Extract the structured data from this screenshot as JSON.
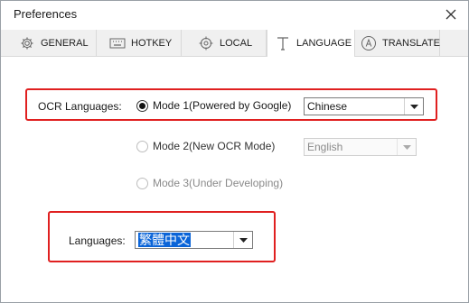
{
  "window": {
    "title": "Preferences"
  },
  "tabs": [
    {
      "label": "GENERAL",
      "icon": "gear-icon",
      "active": false
    },
    {
      "label": "HOTKEY",
      "icon": "keyboard-icon",
      "active": false
    },
    {
      "label": "LOCAL",
      "icon": "target-icon",
      "active": false
    },
    {
      "label": "LANGUAGE",
      "icon": "text-icon",
      "active": true
    },
    {
      "label": "TRANSLATE",
      "icon": "translate-icon",
      "active": false
    }
  ],
  "ocr": {
    "label": "OCR Languages:",
    "mode1": {
      "label": "Mode 1(Powered by Google)",
      "selected": true,
      "language": "Chinese"
    },
    "mode2": {
      "label": "Mode 2(New OCR Mode)",
      "selected": false,
      "language": "English",
      "disabled": true
    },
    "mode3": {
      "label": "Mode 3(Under Developing)",
      "selected": false,
      "disabled": true
    }
  },
  "languages": {
    "label": "Languages:",
    "value": "繁體中文"
  },
  "colors": {
    "highlight": "#e02020",
    "selection": "#0a64d8"
  }
}
